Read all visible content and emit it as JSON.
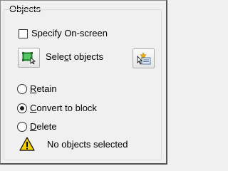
{
  "group": {
    "title": "Objects"
  },
  "specify_onscreen": {
    "label": "Specify On-screen",
    "checked": false
  },
  "select_objects": {
    "label_before": "Sele",
    "label_mnemonic": "c",
    "label_after": "t objects"
  },
  "quick_select": {
    "icon": "quick-select-icon"
  },
  "options": {
    "retain": {
      "mnemonic": "R",
      "rest": "etain",
      "selected": false
    },
    "convert": {
      "mnemonic": "C",
      "rest": "onvert to block",
      "selected": true
    },
    "delete": {
      "mnemonic": "D",
      "rest": "elete",
      "selected": false
    }
  },
  "status": {
    "icon": "warning-icon",
    "text": "No objects selected"
  },
  "colors": {
    "select_icon_green": "#2e9e3a",
    "warning_yellow": "#f5d000"
  }
}
